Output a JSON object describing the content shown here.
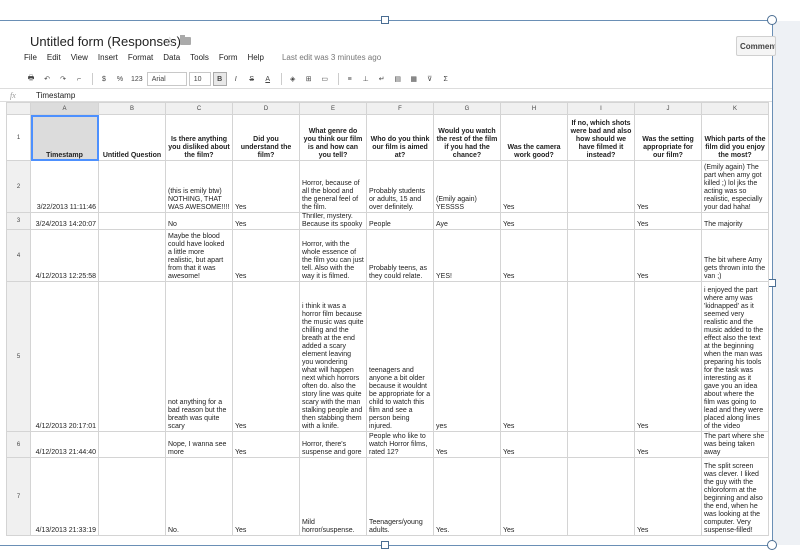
{
  "app": {
    "title": "Untitled form (Responses)",
    "comment_label": "Comments"
  },
  "menu": [
    "File",
    "Edit",
    "View",
    "Insert",
    "Format",
    "Data",
    "Tools",
    "Form",
    "Help"
  ],
  "last_edit": "Last edit was 3 minutes ago",
  "toolbar": {
    "currency": "$",
    "percent": "%",
    "number_format": "123",
    "font": "Arial",
    "font_size": "10",
    "bold": "B",
    "italic": "I",
    "strike": "S",
    "text_color": "A",
    "sum": "Σ"
  },
  "formula_bar": {
    "fx": "fx",
    "value": "Timestamp"
  },
  "columns": [
    "A",
    "B",
    "C",
    "D",
    "E",
    "F",
    "G",
    "H",
    "I",
    "J",
    "K"
  ],
  "header_row": {
    "number": "1",
    "cells": [
      "Timestamp",
      "Untitled Question",
      "Is there anything you disliked about the film?",
      "Did you understand the film?",
      "What genre do you think our film is and how can you tell?",
      "Who do you think our film is aimed at?",
      "Would you watch the rest of the film if you had the chance?",
      "Was the camera work good?",
      "If no, which shots were bad and also how should we have filmed it instead?",
      "Was the setting appropriate for our film?",
      "Which parts of the film did you enjoy the most?"
    ]
  },
  "rows": [
    {
      "number": "2",
      "cells": [
        "3/22/2013 11:11:46",
        "",
        "(this is emily btw) NOTHING, THAT WAS AWESOME!!!!",
        "Yes",
        "Horror, because of all the blood and the general feel of the film.",
        "Probably students or adults, 15 and over definitely.",
        "(Emily again) YESSSS",
        "Yes",
        "",
        "Yes",
        "(Emily again) The part when amy got killed ;) lol jks the acting was so realistic, especially your dad haha!"
      ]
    },
    {
      "number": "3",
      "cells": [
        "3/24/2013 14:20:07",
        "",
        "No",
        "Yes",
        "Thriller, mystery. Because its spooky",
        "People",
        "Aye",
        "Yes",
        "",
        "Yes",
        "The majority"
      ]
    },
    {
      "number": "4",
      "cells": [
        "4/12/2013 12:25:58",
        "",
        "Maybe the blood could have looked a little more realistic, but apart from that it was awesome!",
        "Yes",
        "Horror, with the whole essence of the film you can just tell. Also with the way it is filmed.",
        "Probably teens, as they could relate.",
        "YES!",
        "Yes",
        "",
        "Yes",
        "The bit where Amy gets thrown into the van ;)"
      ]
    },
    {
      "number": "5",
      "cells": [
        "4/12/2013 20:17:01",
        "",
        "not anything for a bad reason but the breath was quite scary",
        "Yes",
        "i think it was a horror film because the music was quite chilling and the breath at the end added a scary element leaving you wondering what will happen next which horrors often do. also the story line was quite scary with the man stalking people and then stabbing them with a knife.",
        "teenagers and anyone a bit older because it wouldnt be appropriate for a child to watch this film and see a person being injured.",
        "yes",
        "Yes",
        "",
        "Yes",
        "i enjoyed the part where amy was 'kidnapped' as it seemed very realistic and the music added to the effect also the text at the beginning when the man was preparing his tools for the task was interesting as it gave you an idea about where the film was going to lead and they were placed along lines of the video"
      ]
    },
    {
      "number": "6",
      "cells": [
        "4/12/2013 21:44:40",
        "",
        "Nope, I wanna see more",
        "Yes",
        "Horror, there's suspense and gore",
        "People who like to watch Horror films, rated 12?",
        "Yes",
        "Yes",
        "",
        "Yes",
        "The part where she was being taken away"
      ]
    },
    {
      "number": "7",
      "cells": [
        "4/13/2013 21:33:19",
        "",
        "No.",
        "Yes",
        "Mild horror/suspense.",
        "Teenagers/young adults.",
        "Yes.",
        "Yes",
        "",
        "Yes",
        "The split screen was clever. I liked the guy with the chloroform at the beginning and also the end, when he was looking at the computer. Very suspense-filled!"
      ]
    }
  ]
}
